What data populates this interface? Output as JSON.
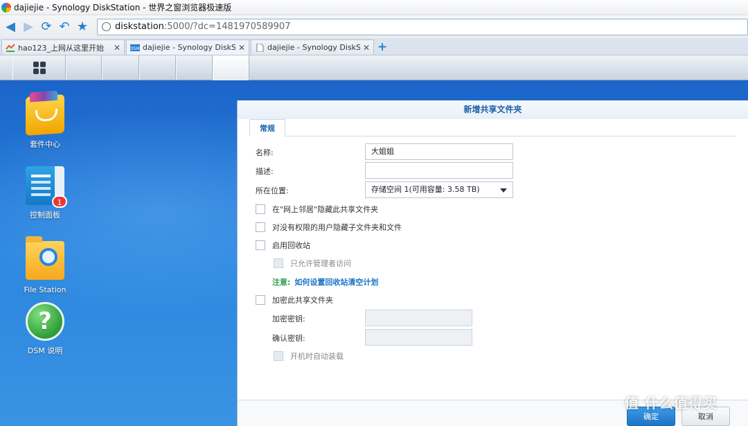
{
  "window": {
    "title": "dajiejie - Synology DiskStation - 世界之窗浏览器极速版"
  },
  "nav": {
    "back_icon": "back-arrow-icon",
    "url_host": "diskstation",
    "url_rest": ":5000/?dc=1481970589907"
  },
  "tabs": [
    {
      "label": "hao123_上网从这里开始",
      "icon": "hao123-favicon"
    },
    {
      "label": "dajiejie - Synology DiskSta",
      "icon": "dsm-favicon"
    },
    {
      "label": "dajiejie - Synology DiskSta",
      "icon": "page-icon"
    }
  ],
  "desktop": {
    "icons": [
      {
        "label": "套件中心",
        "icon": "package-center-icon"
      },
      {
        "label": "控制面板",
        "icon": "control-panel-icon",
        "badge": "1"
      },
      {
        "label": "File Station",
        "icon": "file-station-icon"
      },
      {
        "label": "DSM 说明",
        "icon": "help-icon"
      }
    ]
  },
  "dialog": {
    "title": "新增共享文件夹",
    "tab_general": "常规",
    "name_label": "名称:",
    "name_value": "大姐姐",
    "desc_label": "描述:",
    "desc_value": "",
    "location_label": "所在位置:",
    "location_value": "存储空间 1(可用容量: 3.58 TB)",
    "hide_network_label": "在\"网上邻居\"隐藏此共享文件夹",
    "hide_subfolders_label": "对没有权限的用户隐藏子文件夹和文件",
    "recycle_bin_label": "启用回收站",
    "admin_only_label": "只允许管理者访问",
    "note_label": "注意:",
    "note_link": "如何设置回收站清空计划",
    "encrypt_label": "加密此共享文件夹",
    "enc_key_label": "加密密钥:",
    "confirm_key_label": "确认密钥:",
    "automount_label": "开机时自动装载",
    "ok_label": "确定",
    "cancel_label": "取消"
  },
  "watermark": "值 什么值得买"
}
